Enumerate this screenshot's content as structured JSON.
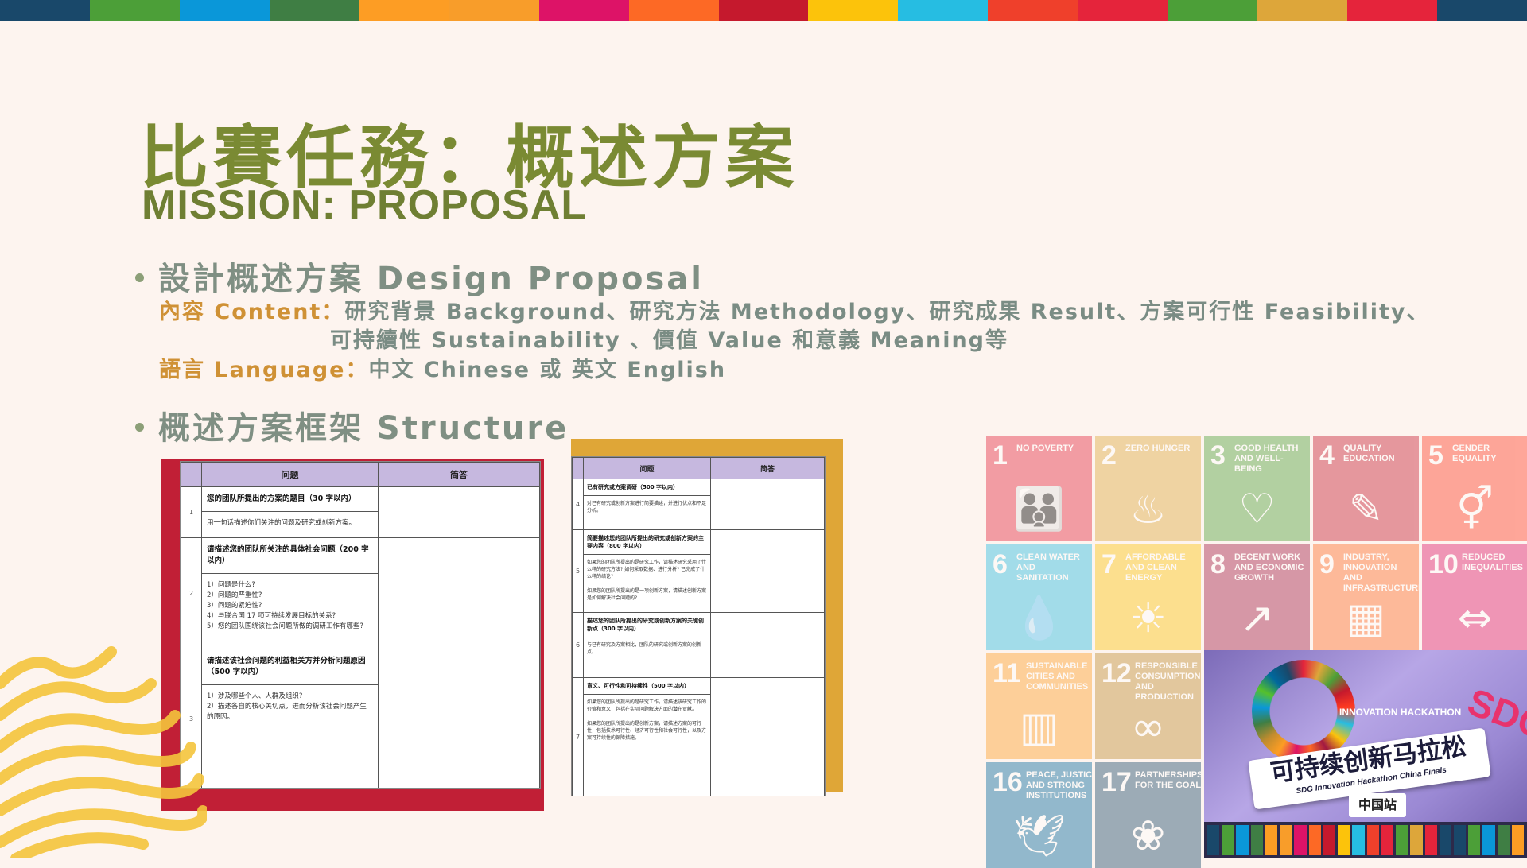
{
  "colors": {
    "top_bar": [
      "#19486a",
      "#4c9f38",
      "#0a97d9",
      "#3f7e44",
      "#fd9d24",
      "#f89d2a",
      "#dd1367",
      "#fd6925",
      "#c5192d",
      "#fcc30b",
      "#26bde2",
      "#ef402b",
      "#e5243b",
      "#4c9f38",
      "#dda63a",
      "#e5243b",
      "#19486a"
    ],
    "title": "#7a8a33",
    "bullet_text": "#7f8f83",
    "key_text": "#cf9135",
    "left_frame": "#c11f36",
    "right_frame": "#dfa637"
  },
  "title": {
    "cn": "比賽任務：概述方案",
    "en": "MISSION: PROPOSAL"
  },
  "bullets": {
    "design": "設計概述方案 Design Proposal",
    "content_key": "內容 Content：",
    "content_line1": "研究背景 Background、研究方法 Methodology、研究成果 Result、方案可行性 Feasibility、",
    "content_line2": "可持續性 Sustainability 、價值 Value 和意義 Meaning等",
    "language_key": "語言 Language：",
    "language_value": "中文 Chinese 或 英文 English",
    "structure": "概述方案框架 Structure"
  },
  "sheet1": {
    "header_q": "问题",
    "header_a": "简答",
    "rows": [
      {
        "num": "1",
        "q": "您的团队所提出的方案的题目（30 字以内）",
        "hint": "用一句话描述你们关注的问题及研究或创新方案。"
      },
      {
        "num": "2",
        "q": "请描述您的团队所关注的具体社会问题（200 字以内）",
        "hint": "1）问题是什么?\n2）问题的严重性?\n3）问题的紧迫性?\n4）与联合国 17 项可持续发展目标的关系?\n5）您的团队围绕该社会问题所做的调研工作有哪些?"
      },
      {
        "num": "3",
        "q": "请描述该社会问题的利益相关方并分析问题原因（500 字以内）",
        "hint": "1）涉及哪些个人、人群及组织?\n2）描述各自的核心关切点，进而分析该社会问题产生的原因。"
      }
    ]
  },
  "sheet2": {
    "header_q": "问题",
    "header_a": "简答",
    "rows": [
      {
        "num": "4",
        "q": "已有研究或方案调研（500 字以内）",
        "hint": "对已有研究或创新方案进行简要描述，并进行优点和不足分析。"
      },
      {
        "num": "5",
        "q": "简要描述您的团队所提出的研究或创新方案的主要内容（800 字以内）",
        "hint": "如果您的团队所提出的是研究工作，请描述研究采用了什么样的研究方法? 如何采取数据、进行分析? 已完成了什么样的结论?\n\n如果您的团队所提出的是一项创新方案，请描述创新方案是如何解决社会问题的?"
      },
      {
        "num": "6",
        "q": "描述您的团队所提出的研究或创新方案的关键创新点（300 字以内）",
        "hint": "与已有研究及方案相比，团队的研究或创新方案的创新点。"
      },
      {
        "num": "7",
        "q": "意义、可行性和可持续性（500 字以内）",
        "hint": "如果您的团队所提出的是研究工作，请描述该研究工作的价值和意义，包括在实际问题解决方面的潜在贡献。\n\n如果您的团队所提出的是创新方案，请描述方案的可行性，包括技术可行性、经济可行性和社会可行性，以及方案可持续性的保障措施。"
      }
    ]
  },
  "sdgs": [
    {
      "n": "1",
      "t": "No Poverty",
      "color": "#e5243b",
      "icon": "family-icon",
      "glyph": "👪"
    },
    {
      "n": "2",
      "t": "Zero Hunger",
      "color": "#dda63a",
      "icon": "bowl-icon",
      "glyph": "♨"
    },
    {
      "n": "3",
      "t": "Good Health and Well-Being",
      "color": "#4c9f38",
      "icon": "heartbeat-icon",
      "glyph": "♡"
    },
    {
      "n": "4",
      "t": "Quality Education",
      "color": "#c5192d",
      "icon": "book-icon",
      "glyph": "✎"
    },
    {
      "n": "5",
      "t": "Gender Equality",
      "color": "#ff3a21",
      "icon": "gender-icon",
      "glyph": "⚥"
    },
    {
      "n": "6",
      "t": "Clean Water and Sanitation",
      "color": "#26bde2",
      "icon": "water-icon",
      "glyph": "💧"
    },
    {
      "n": "7",
      "t": "Affordable and Clean Energy",
      "color": "#fcc30b",
      "icon": "sun-power-icon",
      "glyph": "☀"
    },
    {
      "n": "8",
      "t": "Decent Work and Economic Growth",
      "color": "#a21942",
      "icon": "growth-chart-icon",
      "glyph": "↗"
    },
    {
      "n": "9",
      "t": "Industry, Innovation and Infrastructure",
      "color": "#fd6925",
      "icon": "cubes-icon",
      "glyph": "▦"
    },
    {
      "n": "10",
      "t": "Reduced Inequalities",
      "color": "#dd1367",
      "icon": "equal-arrows-icon",
      "glyph": "⇔"
    },
    {
      "n": "11",
      "t": "Sustainable Cities and Communities",
      "color": "#fd9d24",
      "icon": "buildings-icon",
      "glyph": "▥"
    },
    {
      "n": "12",
      "t": "Responsible Consumption and Production",
      "color": "#bf8b2e",
      "icon": "infinity-icon",
      "glyph": "∞"
    },
    {
      "n": "16",
      "t": "Peace, Justice and Strong Institutions",
      "color": "#00689d",
      "icon": "dove-icon",
      "glyph": "🕊"
    },
    {
      "n": "17",
      "t": "Partnerships for the Goals",
      "color": "#19486a",
      "icon": "flower-icon",
      "glyph": "❀"
    }
  ],
  "photo": {
    "innovation_hackathon": "INNOVATION HACKATHON",
    "banner_cn": "可持续创新马拉松",
    "banner_en": "SDG Innovation Hackathon China Finals",
    "location": "中国站",
    "sdg_letters": "SDG"
  }
}
